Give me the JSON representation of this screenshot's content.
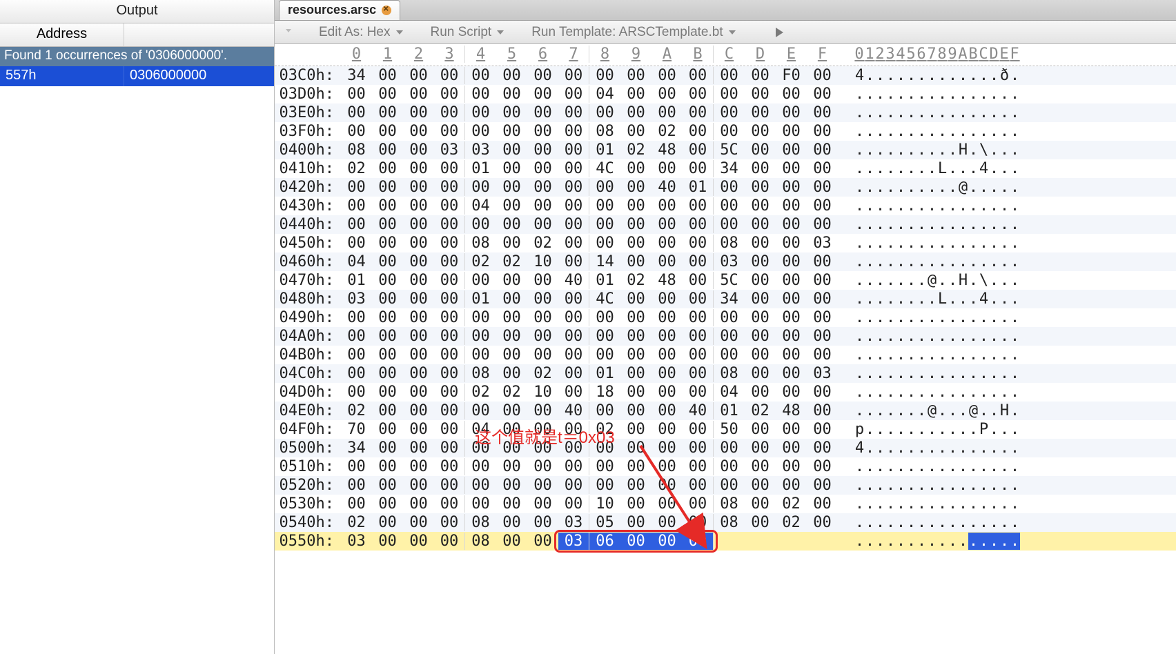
{
  "sidebar": {
    "title": "Output",
    "col_address": "Address",
    "found_msg": "Found 1 occurrences of '0306000000'.",
    "row_addr": "557h",
    "row_val": "0306000000"
  },
  "tab": {
    "filename": "resources.arsc"
  },
  "toolbar": {
    "edit_as": "Edit As: Hex",
    "run_script": "Run Script",
    "run_template": "Run Template: ARSCTemplate.bt"
  },
  "hex_header": {
    "cols": [
      "0",
      "1",
      "2",
      "3",
      "4",
      "5",
      "6",
      "7",
      "8",
      "9",
      "A",
      "B",
      "C",
      "D",
      "E",
      "F"
    ],
    "ascii_cols": [
      "0",
      "1",
      "2",
      "3",
      "4",
      "5",
      "6",
      "7",
      "8",
      "9",
      "A",
      "B",
      "C",
      "D",
      "E",
      "F"
    ]
  },
  "rows": [
    {
      "addr": "03C0h:",
      "b": [
        "34",
        "00",
        "00",
        "00",
        "00",
        "00",
        "00",
        "00",
        "00",
        "00",
        "00",
        "00",
        "00",
        "00",
        "F0",
        "00"
      ],
      "a": "4.............ð."
    },
    {
      "addr": "03D0h:",
      "b": [
        "00",
        "00",
        "00",
        "00",
        "00",
        "00",
        "00",
        "00",
        "04",
        "00",
        "00",
        "00",
        "00",
        "00",
        "00",
        "00"
      ],
      "a": "................"
    },
    {
      "addr": "03E0h:",
      "b": [
        "00",
        "00",
        "00",
        "00",
        "00",
        "00",
        "00",
        "00",
        "00",
        "00",
        "00",
        "00",
        "00",
        "00",
        "00",
        "00"
      ],
      "a": "................"
    },
    {
      "addr": "03F0h:",
      "b": [
        "00",
        "00",
        "00",
        "00",
        "00",
        "00",
        "00",
        "00",
        "08",
        "00",
        "02",
        "00",
        "00",
        "00",
        "00",
        "00"
      ],
      "a": "................"
    },
    {
      "addr": "0400h:",
      "b": [
        "08",
        "00",
        "00",
        "03",
        "03",
        "00",
        "00",
        "00",
        "01",
        "02",
        "48",
        "00",
        "5C",
        "00",
        "00",
        "00"
      ],
      "a": "..........H.\\..."
    },
    {
      "addr": "0410h:",
      "b": [
        "02",
        "00",
        "00",
        "00",
        "01",
        "00",
        "00",
        "00",
        "4C",
        "00",
        "00",
        "00",
        "34",
        "00",
        "00",
        "00"
      ],
      "a": "........L...4..."
    },
    {
      "addr": "0420h:",
      "b": [
        "00",
        "00",
        "00",
        "00",
        "00",
        "00",
        "00",
        "00",
        "00",
        "00",
        "40",
        "01",
        "00",
        "00",
        "00",
        "00"
      ],
      "a": "..........@....."
    },
    {
      "addr": "0430h:",
      "b": [
        "00",
        "00",
        "00",
        "00",
        "04",
        "00",
        "00",
        "00",
        "00",
        "00",
        "00",
        "00",
        "00",
        "00",
        "00",
        "00"
      ],
      "a": "................"
    },
    {
      "addr": "0440h:",
      "b": [
        "00",
        "00",
        "00",
        "00",
        "00",
        "00",
        "00",
        "00",
        "00",
        "00",
        "00",
        "00",
        "00",
        "00",
        "00",
        "00"
      ],
      "a": "................"
    },
    {
      "addr": "0450h:",
      "b": [
        "00",
        "00",
        "00",
        "00",
        "08",
        "00",
        "02",
        "00",
        "00",
        "00",
        "00",
        "00",
        "08",
        "00",
        "00",
        "03"
      ],
      "a": "................"
    },
    {
      "addr": "0460h:",
      "b": [
        "04",
        "00",
        "00",
        "00",
        "02",
        "02",
        "10",
        "00",
        "14",
        "00",
        "00",
        "00",
        "03",
        "00",
        "00",
        "00"
      ],
      "a": "................"
    },
    {
      "addr": "0470h:",
      "b": [
        "01",
        "00",
        "00",
        "00",
        "00",
        "00",
        "00",
        "40",
        "01",
        "02",
        "48",
        "00",
        "5C",
        "00",
        "00",
        "00"
      ],
      "a": ".......@..H.\\..."
    },
    {
      "addr": "0480h:",
      "b": [
        "03",
        "00",
        "00",
        "00",
        "01",
        "00",
        "00",
        "00",
        "4C",
        "00",
        "00",
        "00",
        "34",
        "00",
        "00",
        "00"
      ],
      "a": "........L...4..."
    },
    {
      "addr": "0490h:",
      "b": [
        "00",
        "00",
        "00",
        "00",
        "00",
        "00",
        "00",
        "00",
        "00",
        "00",
        "00",
        "00",
        "00",
        "00",
        "00",
        "00"
      ],
      "a": "................"
    },
    {
      "addr": "04A0h:",
      "b": [
        "00",
        "00",
        "00",
        "00",
        "00",
        "00",
        "00",
        "00",
        "00",
        "00",
        "00",
        "00",
        "00",
        "00",
        "00",
        "00"
      ],
      "a": "................"
    },
    {
      "addr": "04B0h:",
      "b": [
        "00",
        "00",
        "00",
        "00",
        "00",
        "00",
        "00",
        "00",
        "00",
        "00",
        "00",
        "00",
        "00",
        "00",
        "00",
        "00"
      ],
      "a": "................"
    },
    {
      "addr": "04C0h:",
      "b": [
        "00",
        "00",
        "00",
        "00",
        "08",
        "00",
        "02",
        "00",
        "01",
        "00",
        "00",
        "00",
        "08",
        "00",
        "00",
        "03"
      ],
      "a": "................"
    },
    {
      "addr": "04D0h:",
      "b": [
        "00",
        "00",
        "00",
        "00",
        "02",
        "02",
        "10",
        "00",
        "18",
        "00",
        "00",
        "00",
        "04",
        "00",
        "00",
        "00"
      ],
      "a": "................"
    },
    {
      "addr": "04E0h:",
      "b": [
        "02",
        "00",
        "00",
        "00",
        "00",
        "00",
        "00",
        "40",
        "00",
        "00",
        "00",
        "40",
        "01",
        "02",
        "48",
        "00"
      ],
      "a": ".......@...@..H."
    },
    {
      "addr": "04F0h:",
      "b": [
        "70",
        "00",
        "00",
        "00",
        "04",
        "00",
        "00",
        "00",
        "02",
        "00",
        "00",
        "00",
        "50",
        "00",
        "00",
        "00"
      ],
      "a": "p...........P..."
    },
    {
      "addr": "0500h:",
      "b": [
        "34",
        "00",
        "00",
        "00",
        "00",
        "00",
        "00",
        "00",
        "00",
        "00",
        "00",
        "00",
        "00",
        "00",
        "00",
        "00"
      ],
      "a": "4..............."
    },
    {
      "addr": "0510h:",
      "b": [
        "00",
        "00",
        "00",
        "00",
        "00",
        "00",
        "00",
        "00",
        "00",
        "00",
        "00",
        "00",
        "00",
        "00",
        "00",
        "00"
      ],
      "a": "................"
    },
    {
      "addr": "0520h:",
      "b": [
        "00",
        "00",
        "00",
        "00",
        "00",
        "00",
        "00",
        "00",
        "00",
        "00",
        "00",
        "00",
        "00",
        "00",
        "00",
        "00"
      ],
      "a": "................"
    },
    {
      "addr": "0530h:",
      "b": [
        "00",
        "00",
        "00",
        "00",
        "00",
        "00",
        "00",
        "00",
        "10",
        "00",
        "00",
        "00",
        "08",
        "00",
        "02",
        "00"
      ],
      "a": "................"
    },
    {
      "addr": "0540h:",
      "b": [
        "02",
        "00",
        "00",
        "00",
        "08",
        "00",
        "00",
        "03",
        "05",
        "00",
        "00",
        "00",
        "08",
        "00",
        "02",
        "00"
      ],
      "a": "................"
    },
    {
      "addr": "0550h:",
      "b": [
        "03",
        "00",
        "00",
        "00",
        "08",
        "00",
        "00",
        "03",
        "06",
        "00",
        "00",
        "00",
        "",
        "",
        "",
        ""
      ],
      "a": "................",
      "last": true,
      "sel_start": 7,
      "sel_end": 11,
      "ascii_sel_start": 11,
      "ascii_sel_end": 15
    }
  ],
  "annotation": {
    "text": "这个值就是t＝0x03"
  }
}
